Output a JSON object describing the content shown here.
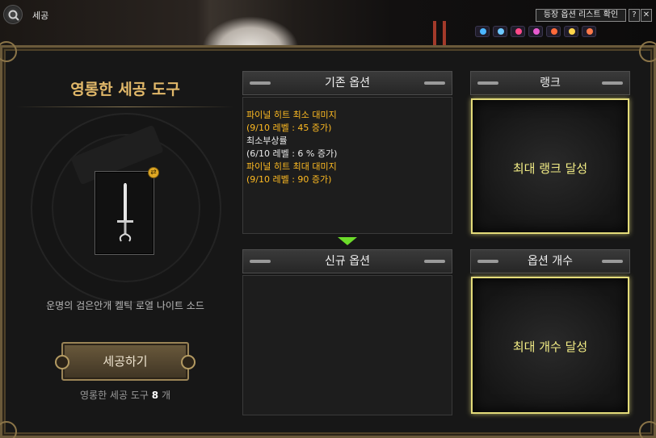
{
  "window": {
    "title": "세공",
    "list_button": "등장 옵션 리스트 확인",
    "help_label": "?",
    "close_label": "✕"
  },
  "tool": {
    "title": "영롱한 세공 도구",
    "item_name": "운명의 검은안개 켈틱 로열 나이트 소드",
    "craft_button": "세공하기",
    "count_prefix": "영롱한 세공 도구",
    "count_value": "8",
    "count_suffix": "개"
  },
  "existing_options": {
    "header": "기존 옵션",
    "lines": [
      {
        "text": "파이널 히트 최소 대미지",
        "color": "gold"
      },
      {
        "text": "(9/10 레벨 : 45 증가)",
        "color": "gold"
      },
      {
        "text": "최소부상률",
        "color": "white"
      },
      {
        "text": "(6/10 레벨 : 6 % 증가)",
        "color": "white"
      },
      {
        "text": "파이널 히트 최대 대미지",
        "color": "gold"
      },
      {
        "text": "(9/10 레벨 : 90 증가)",
        "color": "gold"
      }
    ]
  },
  "new_options": {
    "header": "신규 옵션"
  },
  "rank": {
    "header": "랭크",
    "status": "최대 랭크 달성"
  },
  "option_count": {
    "header": "옵션 개수",
    "status": "최대 개수 달성"
  },
  "colors": {
    "gold_text": "#ffbb22",
    "status_text": "#f4ee86",
    "title_text": "#e2b96a",
    "arrow": "#6cdc2a"
  }
}
